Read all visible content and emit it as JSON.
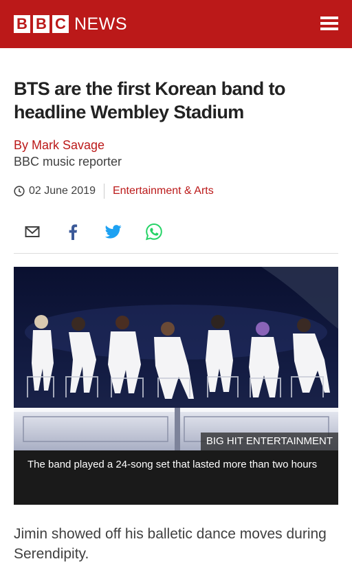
{
  "header": {
    "logo_letters": [
      "B",
      "B",
      "C"
    ],
    "logo_word": "NEWS",
    "menu_icon": "hamburger-icon"
  },
  "article": {
    "headline": "BTS are the first Korean band to headline Wembley Stadium",
    "author": "By Mark Savage",
    "author_role": "BBC music reporter",
    "date": "02 June 2019",
    "section": "Entertainment & Arts"
  },
  "share": {
    "icons": [
      "email-icon",
      "facebook-icon",
      "twitter-icon",
      "whatsapp-icon"
    ]
  },
  "figure": {
    "credit": "BIG HIT ENTERTAINMENT",
    "caption": "The band played a 24-song set that lasted more than two hours"
  },
  "body": {
    "first_paragraph": "Jimin showed off his balletic dance moves during Serendipity."
  },
  "colors": {
    "brand_red": "#bb1919",
    "text": "#222222",
    "muted": "#404040",
    "caption_bg": "#1a1a1a"
  }
}
